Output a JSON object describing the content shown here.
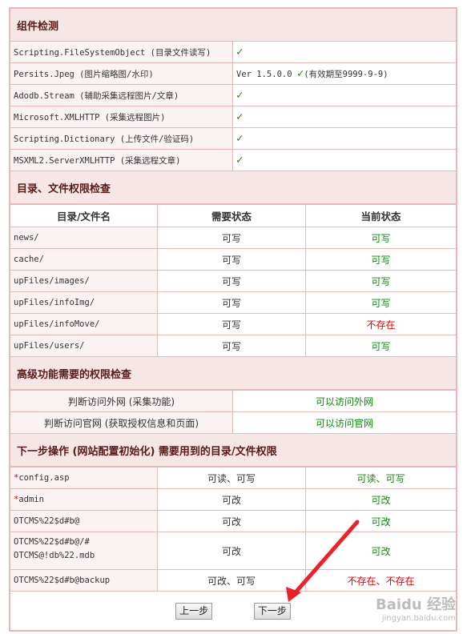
{
  "components": {
    "title": "组件检测",
    "rows": [
      {
        "name": "Scripting.FileSystemObject (目录文件读写)",
        "status": "✓",
        "note": ""
      },
      {
        "name": "Persits.Jpeg (图片缩略图/水印)",
        "status": "✓",
        "note": "Ver 1.5.0.0",
        "extra": "(有效期至9999-9-9)"
      },
      {
        "name": "Adodb.Stream (辅助采集远程图片/文章)",
        "status": "✓",
        "note": ""
      },
      {
        "name": "Microsoft.XMLHTTP (采集远程图片)",
        "status": "✓",
        "note": ""
      },
      {
        "name": "Scripting.Dictionary (上传文件/验证码)",
        "status": "✓",
        "note": ""
      },
      {
        "name": "MSXML2.ServerXMLHTTP (采集远程文章)",
        "status": "✓",
        "note": ""
      }
    ]
  },
  "dirs": {
    "title": "目录、文件权限检查",
    "headers": [
      "目录/文件名",
      "需要状态",
      "当前状态"
    ],
    "rows": [
      {
        "path": "news/",
        "need": "可写",
        "cur": "可写",
        "ok": true
      },
      {
        "path": "cache/",
        "need": "可写",
        "cur": "可写",
        "ok": true
      },
      {
        "path": "upFiles/images/",
        "need": "可写",
        "cur": "可写",
        "ok": true
      },
      {
        "path": "upFiles/infoImg/",
        "need": "可写",
        "cur": "可写",
        "ok": true
      },
      {
        "path": "upFiles/infoMove/",
        "need": "可写",
        "cur": "不存在",
        "ok": false
      },
      {
        "path": "upFiles/users/",
        "need": "可写",
        "cur": "可写",
        "ok": true
      }
    ]
  },
  "advanced": {
    "title": "高级功能需要的权限检查",
    "rows": [
      {
        "label": "判断访问外网 (采集功能)",
        "value": "可以访问外网"
      },
      {
        "label": "判断访问官网 (获取授权信息和页面)",
        "value": "可以访问官网"
      }
    ]
  },
  "next": {
    "title": "下一步操作 (网站配置初始化) 需要用到的目录/文件权限",
    "rows": [
      {
        "star": "*",
        "path": "config.asp",
        "path2": "",
        "need": "可读、可写",
        "cur": "可读、可写",
        "ok": true
      },
      {
        "star": "*",
        "path": "admin",
        "path2": "",
        "need": "可改",
        "cur": "可改",
        "ok": true
      },
      {
        "star": "",
        "path": "OTCMS%22$d#b@",
        "path2": "",
        "need": "可改",
        "cur": "可改",
        "ok": true
      },
      {
        "star": "",
        "path": "OTCMS%22$d#b@/#",
        "path2": "OTCMS@!db%22.mdb",
        "need": "可改",
        "cur": "可改",
        "ok": true
      },
      {
        "star": "",
        "path": "OTCMS%22$d#b@backup",
        "path2": "",
        "need": "可改、可写",
        "cur": "不存在、不存在",
        "ok": false
      }
    ]
  },
  "buttons": {
    "prev": "上一步",
    "next": "下一步"
  },
  "watermark": {
    "brand": "Baidu 经验",
    "url": "jingyan.baidu.com"
  },
  "colors": {
    "ok": "#0a8a0a",
    "bad": "#e00000",
    "arrow": "#e8232a",
    "section_bg": "#f7e6e6",
    "border": "#e6b9b9"
  }
}
